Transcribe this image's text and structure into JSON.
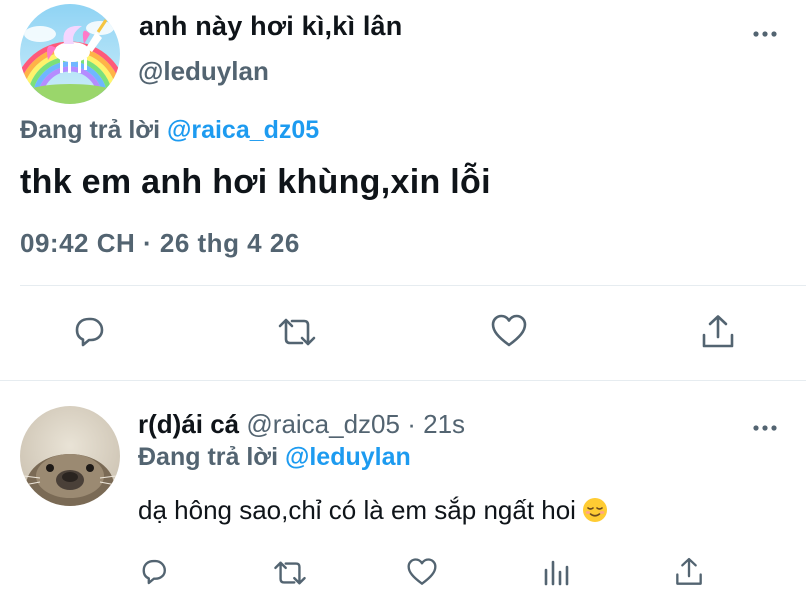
{
  "main_tweet": {
    "display_name": "anh này hơi kì,kì lân",
    "handle": "@leduylan",
    "replying_prefix": "Đang trả lời",
    "replying_to": "@raica_dz05",
    "text": "thk em anh hơi khùng,xin lỗi",
    "timestamp": "09:42 CH · 26 thg 4 26",
    "actions": [
      "reply-icon",
      "retweet-icon",
      "like-icon",
      "share-icon"
    ]
  },
  "reply_tweet": {
    "display_name": "r(d)ái cá",
    "handle": "@raica_dz05",
    "separator": "·",
    "time_ago": "21s",
    "replying_prefix": "Đang trả lời",
    "replying_to": "@leduylan",
    "text": "dạ hông sao,chỉ có là em sắp ngất hoi",
    "emoji": "relieved-face-emoji",
    "actions": [
      "reply-icon",
      "retweet-icon",
      "like-icon",
      "analytics-icon",
      "share-icon"
    ]
  },
  "colors": {
    "text": "#0f1419",
    "muted": "#536471",
    "link": "#1d9bf0",
    "divider": "#e6ecf0"
  }
}
